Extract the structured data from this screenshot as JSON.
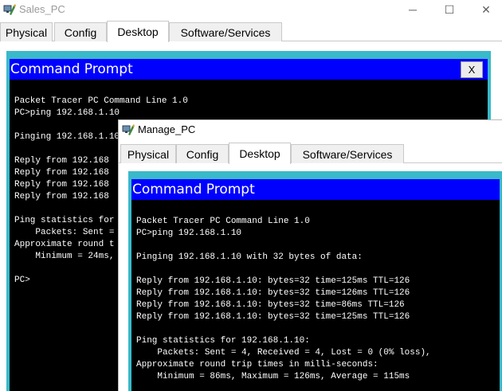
{
  "sales_window": {
    "title": "Sales_PC",
    "tabs": [
      "Physical",
      "Config",
      "Desktop",
      "Software/Services"
    ],
    "active_tab": "Desktop",
    "controls": {
      "minimize": "─",
      "maximize": "☐",
      "close": "✕"
    },
    "command_prompt": {
      "title": "Command Prompt",
      "close_label": "X",
      "lines": [
        "Packet Tracer PC Command Line 1.0",
        "PC>ping 192.168.1.10",
        "",
        "Pinging 192.168.1.10",
        "",
        "Reply from 192.168",
        "Reply from 192.168",
        "Reply from 192.168",
        "Reply from 192.168",
        "",
        "Ping statistics for",
        "    Packets: Sent =",
        "Approximate round t",
        "    Minimum = 24ms,",
        "",
        "PC>"
      ]
    }
  },
  "manage_window": {
    "title": "Manage_PC",
    "tabs": [
      "Physical",
      "Config",
      "Desktop",
      "Software/Services"
    ],
    "active_tab": "Desktop",
    "command_prompt": {
      "title": "Command Prompt",
      "lines": [
        "Packet Tracer PC Command Line 1.0",
        "PC>ping 192.168.1.10",
        "",
        "Pinging 192.168.1.10 with 32 bytes of data:",
        "",
        "Reply from 192.168.1.10: bytes=32 time=125ms TTL=126",
        "Reply from 192.168.1.10: bytes=32 time=126ms TTL=126",
        "Reply from 192.168.1.10: bytes=32 time=86ms TTL=126",
        "Reply from 192.168.1.10: bytes=32 time=125ms TTL=126",
        "",
        "Ping statistics for 192.168.1.10:",
        "    Packets: Sent = 4, Received = 4, Lost = 0 (0% loss),",
        "Approximate round trip times in milli-seconds:",
        "    Minimum = 86ms, Maximum = 126ms, Average = 115ms"
      ]
    }
  },
  "colors": {
    "prompt_title_bg": "#0000ff",
    "terminal_bg": "#000000",
    "terminal_fg": "#ffffff",
    "frame": "#39b9c9"
  },
  "icons": {
    "app": "packet-tracer-pc-icon"
  }
}
